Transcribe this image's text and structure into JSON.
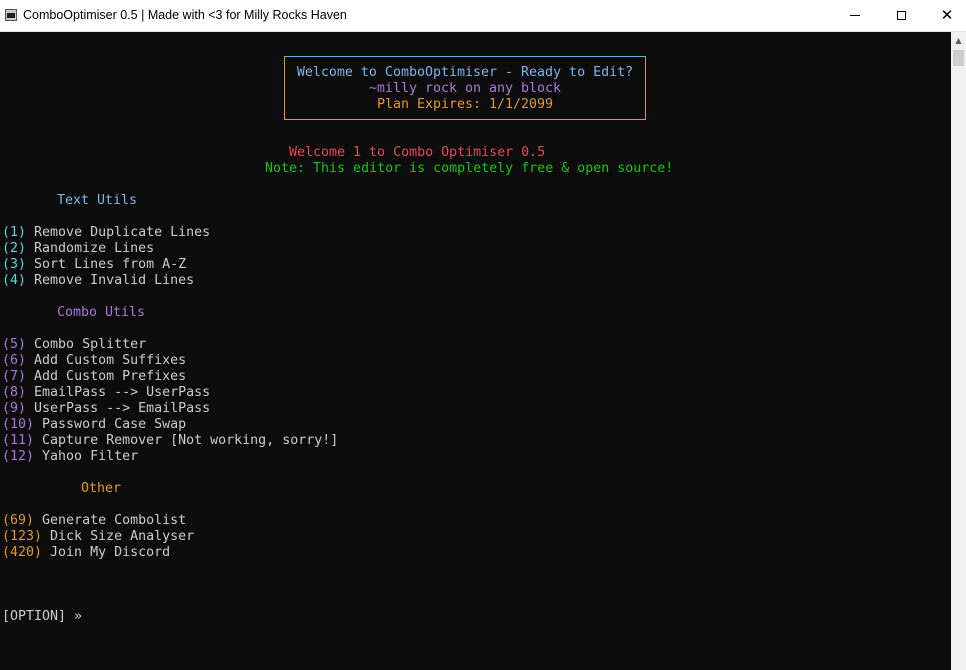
{
  "window": {
    "title": "ComboOptimiser 0.5 | Made with <3 for Milly Rocks Haven",
    "icon": "console-icon",
    "minimize_glyph": "",
    "close_glyph": "✕"
  },
  "banner": {
    "line1": "Welcome to ComboOptimiser - Ready to Edit?",
    "line2": "~milly rock on any block",
    "line3": "Plan Expires: 1/1/2099",
    "colors": {
      "line1": "#7fb3e6",
      "line2": "#a57bd6",
      "line3": "#e5982d"
    }
  },
  "welcome": "Welcome 1 to Combo Optimiser 0.5",
  "note": "Note: This editor is completely free & open source!",
  "sections": [
    {
      "heading": "Text Utils",
      "color": "#7fb3e6",
      "items": [
        {
          "num": "(1)",
          "label": " Remove Duplicate Lines"
        },
        {
          "num": "(2)",
          "label": " Randomize Lines"
        },
        {
          "num": "(3)",
          "label": " Sort Lines from A-Z"
        },
        {
          "num": "(4)",
          "label": " Remove Invalid Lines"
        }
      ]
    },
    {
      "heading": "Combo Utils",
      "color": "#a57bd6",
      "items": [
        {
          "num": "(5)",
          "label": " Combo Splitter"
        },
        {
          "num": "(6)",
          "label": " Add Custom Suffixes"
        },
        {
          "num": "(7)",
          "label": " Add Custom Prefixes"
        },
        {
          "num": "(8)",
          "label": " EmailPass --> UserPass"
        },
        {
          "num": "(9)",
          "label": " UserPass --> EmailPass"
        },
        {
          "num": "(10)",
          "label": " Password Case Swap"
        },
        {
          "num": "(11)",
          "label": " Capture Remover [Not working, sorry!]"
        },
        {
          "num": "(12)",
          "label": " Yahoo Filter"
        }
      ]
    },
    {
      "heading": "Other",
      "color": "#e5982d",
      "items": [
        {
          "num": "(69)",
          "label": " Generate Combolist"
        },
        {
          "num": "(123)",
          "label": " Dick Size Analyser"
        },
        {
          "num": "(420)",
          "label": " Join My Discord"
        }
      ]
    }
  ],
  "prompt": "[OPTION] »"
}
